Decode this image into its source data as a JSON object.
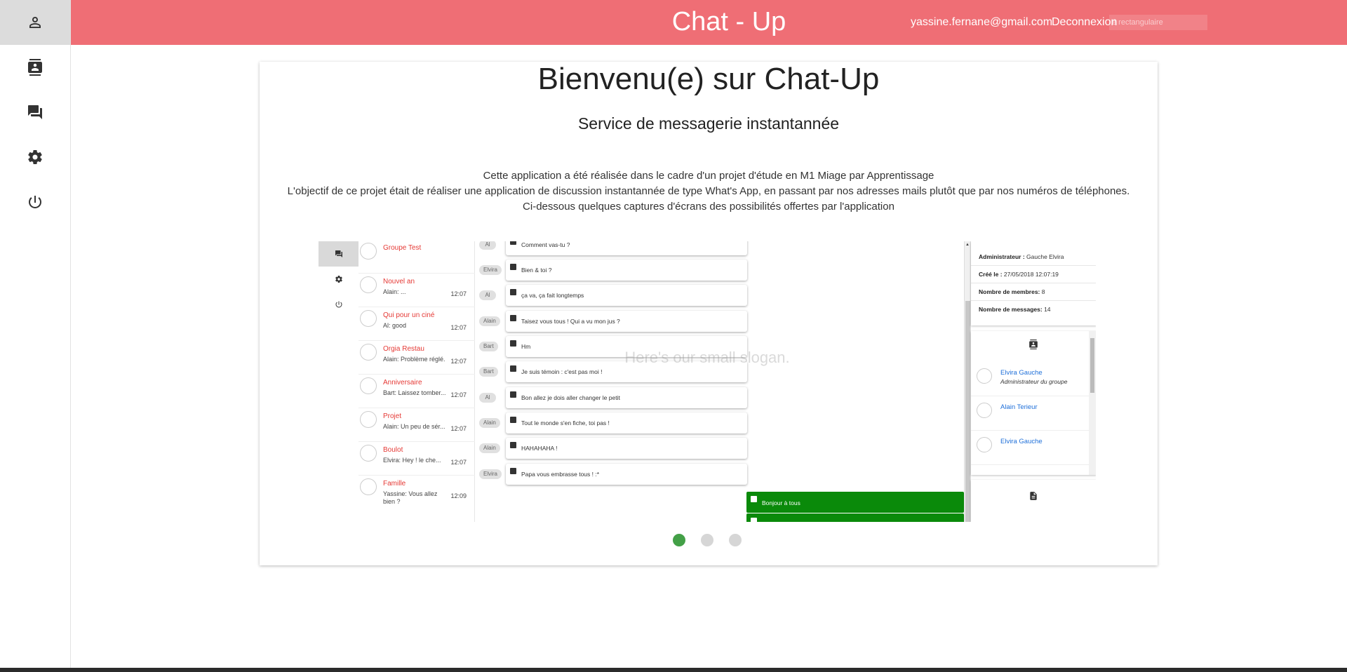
{
  "header": {
    "title": "Chat - Up",
    "user_email": "yassine.fernane@gmail.com",
    "logout_label": "Deconnexion",
    "ghost_input_value": "e rectangulaire",
    "background_color": "#ef6e75"
  },
  "sidebar": {
    "items": [
      {
        "icon": "person-outline-icon",
        "active": true
      },
      {
        "icon": "contacts-icon",
        "active": false
      },
      {
        "icon": "forum-icon",
        "active": false
      },
      {
        "icon": "settings-gear-icon",
        "active": false
      },
      {
        "icon": "power-icon",
        "active": false
      }
    ]
  },
  "card": {
    "title": "Bienvenu(e) sur Chat-Up",
    "subtitle": "Service de messagerie instantannée",
    "description_lines": [
      "Cette application a été réalisée dans le cadre d'un projet d'étude en M1 Miage par Apprentissage",
      "L'objectif de ce projet était de réaliser une application de discussion instantannée de type What's App, en passant par nos adresses mails plutôt que par nos numéros de téléphones.",
      "Ci-dessous quelques captures d'écrans des possibilités offertes par l'application"
    ],
    "slogan": "Here's our small slogan.",
    "carousel": {
      "slide_count": 3,
      "active_index": 0,
      "active_color": "#43a047"
    }
  },
  "screenshot": {
    "conversations": [
      {
        "name": "Groupe Test",
        "preview": "",
        "time": ""
      },
      {
        "name": "Nouvel an",
        "preview": "Alain: ...",
        "time": "12:07"
      },
      {
        "name": "Qui pour un ciné",
        "preview": "Al: good",
        "time": "12:07"
      },
      {
        "name": "Orgia Restau",
        "preview": "Alain: Problème réglé.",
        "time": "12:07"
      },
      {
        "name": "Anniversaire",
        "preview": "Bart: Laissez tomber...",
        "time": "12:07"
      },
      {
        "name": "Projet",
        "preview": "Alain: Un peu de sér...",
        "time": "12:07"
      },
      {
        "name": "Boulot",
        "preview": "Elvira: Hey ! le che...",
        "time": "12:07"
      },
      {
        "name": "Famille",
        "preview": "Yassine: Vous allez bien ?",
        "time": "12:09"
      }
    ],
    "messages": [
      {
        "who": "Al",
        "text": "Comment vas-tu ?"
      },
      {
        "who": "Elvira",
        "text": "Bien & toi ?"
      },
      {
        "who": "Al",
        "text": "ça va, ça fait longtemps"
      },
      {
        "who": "Alain",
        "text": "Taisez vous tous ! Qui a vu mon jus ?"
      },
      {
        "who": "Bart",
        "text": "Hm"
      },
      {
        "who": "Bart",
        "text": "Je suis témoin : c'est pas moi !"
      },
      {
        "who": "Al",
        "text": "Bon allez je dois aller changer le petit"
      },
      {
        "who": "Alain",
        "text": "Tout le monde s'en fiche, toi pas !"
      },
      {
        "who": "Alain",
        "text": "HAHAHAHA !"
      },
      {
        "who": "Elvira",
        "text": "Papa vous embrasse tous ! :*"
      }
    ],
    "my_messages": [
      "Bonjour à tous",
      ""
    ],
    "my_message_color": "#0a8a0a",
    "info": {
      "admin_label": "Administrateur :",
      "admin_value": "Gauche Elvira",
      "created_label": "Créé le :",
      "created_value": "27/05/2018 12:07:19",
      "members_label": "Nombre de membres:",
      "members_value": "8",
      "messages_label": "Nombre de messages:",
      "messages_value": "14"
    },
    "members": [
      {
        "name": "Elvira Gauche",
        "role": "Administrateur du groupe"
      },
      {
        "name": "Alain Terieur",
        "role": ""
      },
      {
        "name": "Elvira Gauche",
        "role": ""
      }
    ]
  }
}
